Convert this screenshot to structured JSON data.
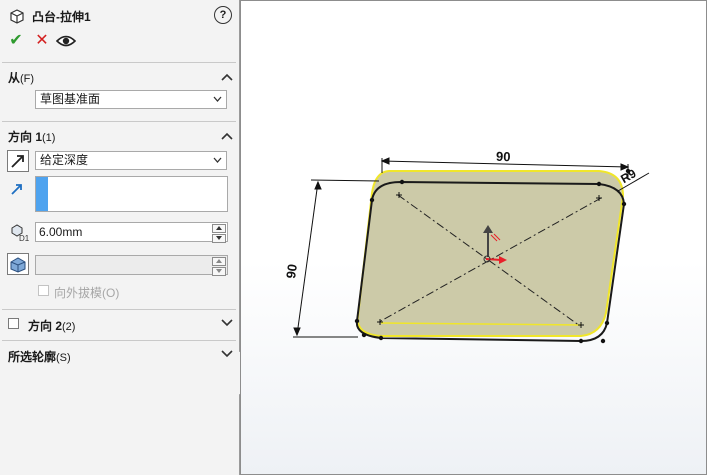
{
  "header": {
    "title": "凸台-拉伸1",
    "help": "?"
  },
  "actions": {
    "ok": "✔",
    "cancel": "✕",
    "preview": "preview-eye"
  },
  "from": {
    "title": "从",
    "shortcut": "(F)",
    "start_condition": "草图基准面"
  },
  "direction1": {
    "title": "方向 1",
    "shortcut": "(1)",
    "end_condition": "给定深度",
    "depth": "6.00mm",
    "draft_value": "",
    "draft_outward_label": "向外拔模",
    "draft_outward_shortcut": "(O)"
  },
  "direction2": {
    "title": "方向 2",
    "shortcut": "(2)"
  },
  "selected_contours": {
    "title": "所选轮廓",
    "shortcut": "(S)"
  },
  "viewport": {
    "dim_top": "90",
    "dim_left": "90",
    "dim_corner": "R9",
    "colors": {
      "face_fill": "#c9c7a3",
      "edge_highlight": "#f0e62a",
      "sketch": "#1a1a1a",
      "axis_red": "#e8202a"
    }
  }
}
